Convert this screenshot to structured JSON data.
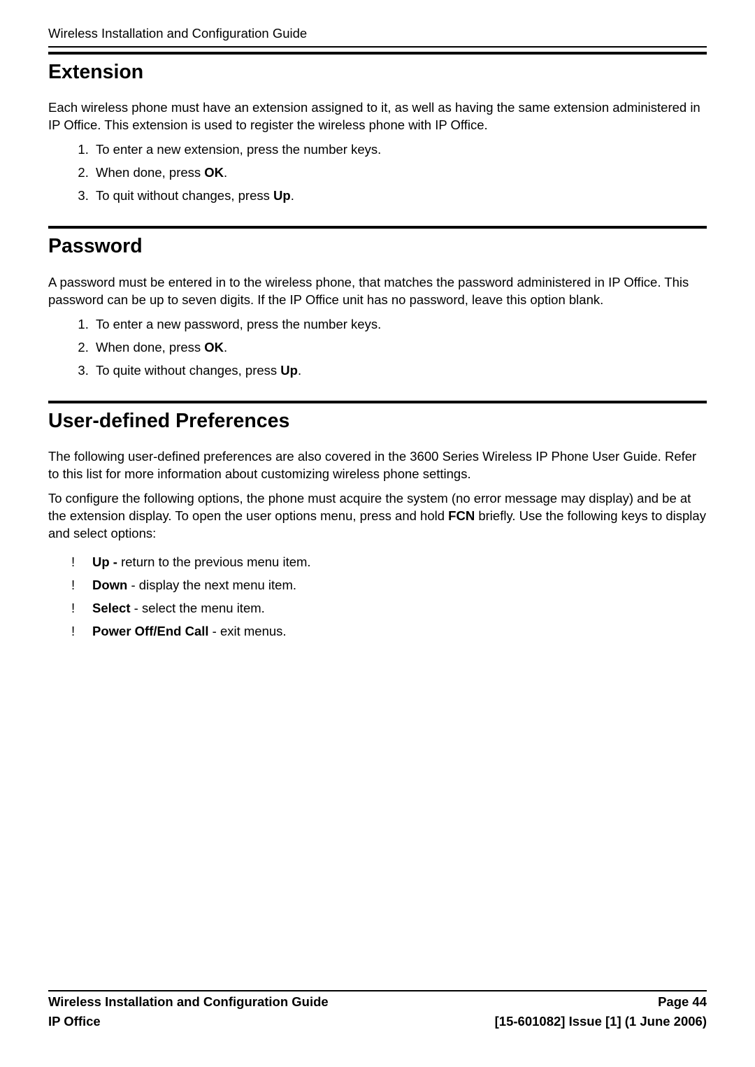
{
  "header": {
    "title": "Wireless Installation and Configuration Guide"
  },
  "sections": {
    "extension": {
      "heading": "Extension",
      "intro": "Each wireless phone must have an extension assigned to it, as well as having the same extension administered in IP Office. This extension is used to register the wireless phone with IP Office.",
      "steps": {
        "s1": "To enter a new extension, press the number keys.",
        "s2_prefix": "When done, press ",
        "s2_bold": "OK",
        "s2_suffix": ".",
        "s3_prefix": "To quit without changes, press ",
        "s3_bold": "Up",
        "s3_suffix": "."
      }
    },
    "password": {
      "heading": "Password",
      "intro": "A password must be entered in to the wireless phone, that matches the password administered in IP Office. This password can be up to seven digits. If the IP Office unit has no password, leave this option blank.",
      "steps": {
        "s1": "To enter a new password, press the number keys.",
        "s2_prefix": "When done, press ",
        "s2_bold": "OK",
        "s2_suffix": ".",
        "s3_prefix": "To quite without changes, press ",
        "s3_bold": "Up",
        "s3_suffix": "."
      }
    },
    "prefs": {
      "heading": "User-defined Preferences",
      "p1": "The following user-defined preferences are also covered in the 3600 Series Wireless IP Phone User Guide. Refer to this list for more information about customizing wireless phone settings.",
      "p2_prefix": "To configure the following options, the phone must acquire the system (no error message may display) and be at the extension display. To open the user options menu, press and hold ",
      "p2_bold": "FCN",
      "p2_suffix": " briefly. Use the following keys to display and select options:",
      "bullets": {
        "b1_bold": "Up -",
        "b1_text": " return to the previous menu item.",
        "b2_bold": "Down",
        "b2_text": " - display the next menu item.",
        "b3_bold": "Select",
        "b3_text": " - select the menu item.",
        "b4_bold": "Power Off/End Call",
        "b4_text": " - exit menus."
      }
    }
  },
  "footer": {
    "left1": "Wireless Installation and Configuration Guide",
    "right1": "Page 44",
    "left2": "IP Office",
    "right2": "[15-601082] Issue [1] (1 June 2006)"
  }
}
